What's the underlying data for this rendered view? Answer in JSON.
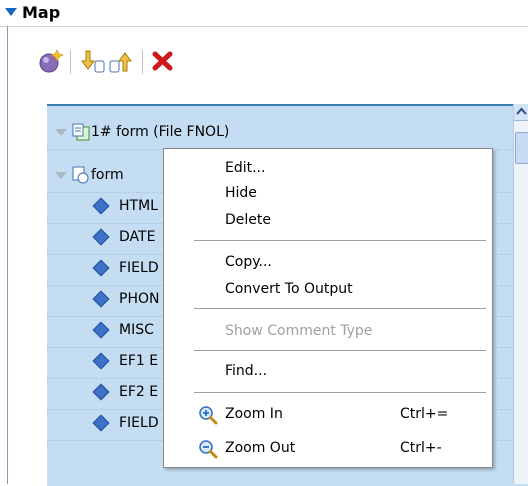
{
  "section": {
    "title": "Map"
  },
  "toolbar": {
    "buttons": [
      {
        "name": "add-icon"
      },
      {
        "name": "move-down-icon"
      },
      {
        "name": "move-up-icon"
      },
      {
        "name": "delete-icon"
      }
    ]
  },
  "tree": {
    "root": "1# form (File FNOL)",
    "form": "form",
    "children": [
      "HTML",
      "DATE",
      "FIELD",
      "PHON",
      "MISC",
      "EF1 E",
      "EF2 E",
      "FIELD"
    ]
  },
  "context_menu": {
    "items": {
      "edit": "Edit...",
      "hide": "Hide",
      "delete": "Delete",
      "copy": "Copy...",
      "convert": "Convert To Output",
      "show_comment": "Show Comment Type",
      "find": "Find...",
      "zoom_in": "Zoom In",
      "zoom_in_shortcut": "Ctrl+=",
      "zoom_out": "Zoom Out",
      "zoom_out_shortcut": "Ctrl+-"
    }
  },
  "colors": {
    "tree_background": "#c4ddf3",
    "accent": "#3c7fb1",
    "delete_red": "#d01818"
  }
}
